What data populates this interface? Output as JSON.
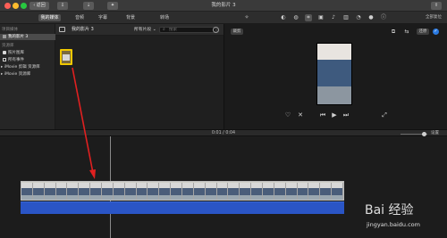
{
  "window": {
    "title": "我的影片 3",
    "back_label": "返回",
    "colors": {
      "titlebar": "#3a3a3a",
      "close": "#ff5f57",
      "minimize": "#febc2e",
      "zoom": "#28c840"
    }
  },
  "toolbar": {
    "tabs": [
      {
        "label": "我的媒体",
        "active": true
      },
      {
        "label": "音频",
        "active": false
      },
      {
        "label": "字幕",
        "active": false
      },
      {
        "label": "背景",
        "active": false
      },
      {
        "label": "转场",
        "active": false
      }
    ],
    "adjust_icons": [
      "magic-wand-icon",
      "color-balance-icon",
      "color-correction-icon",
      "crop-icon",
      "stabilization-icon",
      "volume-icon",
      "noise-reduction-icon",
      "speed-icon",
      "filter-icon",
      "info-icon"
    ],
    "reset_all_label": "全部复位"
  },
  "sidebar": {
    "items": [
      {
        "label": "项目媒体",
        "type": "section"
      },
      {
        "label": "我的影片 3",
        "type": "item",
        "selected": true
      },
      {
        "label": "资源库",
        "type": "section"
      },
      {
        "label": "照片图库",
        "type": "item"
      },
      {
        "label": "所有事件",
        "type": "item"
      },
      {
        "label": "iMovie 剪辑 资源库",
        "type": "item"
      },
      {
        "label": "iMovie 资源库",
        "type": "item"
      }
    ]
  },
  "browser": {
    "title": "我的影片 3",
    "filter_label": "所有片段",
    "search_placeholder": "搜索"
  },
  "viewer": {
    "crop_label": "裁剪",
    "reset_label": "还原"
  },
  "timeline": {
    "timecode_current": "0:01",
    "timecode_total": "0:04",
    "settings_label": "设置",
    "clip_frame_count": 28
  },
  "watermark": {
    "logo": "Bai 经验",
    "url": "jingyan.baidu.com"
  },
  "colors": {
    "accent_blue": "#2a55c6",
    "selection_yellow": "#f0c800",
    "arrow_red": "#e02020"
  }
}
